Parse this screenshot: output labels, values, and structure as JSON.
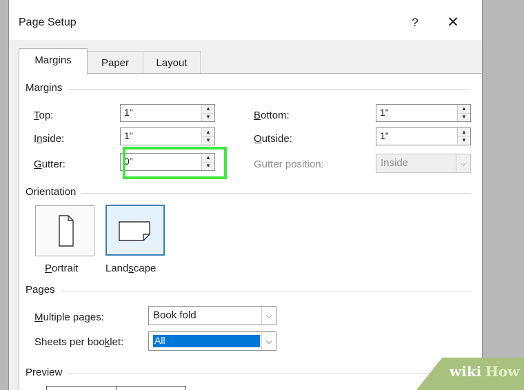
{
  "window": {
    "title": "Page Setup",
    "help": "?",
    "close": "✕"
  },
  "tabs": [
    {
      "label": "Margins",
      "active": true
    },
    {
      "label": "Paper"
    },
    {
      "label": "Layout"
    }
  ],
  "margins_section": {
    "title": "Margins",
    "top": {
      "key": "T",
      "rest": "op:",
      "value": "1\""
    },
    "inside": {
      "pre": "I",
      "key": "n",
      "rest": "side:",
      "value": "1\""
    },
    "gutter": {
      "key": "G",
      "rest": "utter:",
      "value": "0\""
    },
    "bottom": {
      "key": "B",
      "rest": "ottom:",
      "value": "1\""
    },
    "outside": {
      "key": "O",
      "rest": "utside:",
      "value": "1\""
    },
    "gutter_position": {
      "label": "Gutter position:",
      "value": "Inside"
    }
  },
  "orientation_section": {
    "title": "Orientation",
    "portrait": {
      "key": "P",
      "rest": "ortrait"
    },
    "landscape": {
      "pre": "Land",
      "key": "s",
      "rest": "cape"
    }
  },
  "pages_section": {
    "title": "Pages",
    "multiple_pages": {
      "key": "M",
      "rest": "ultiple pages:",
      "value": "Book fold"
    },
    "sheets_per_booklet": {
      "pre": "Sheets per boo",
      "key": "k",
      "rest": "let:",
      "value": "All"
    }
  },
  "preview_section": {
    "title": "Preview"
  },
  "watermark": {
    "wiki": "wiki",
    "how": "How"
  },
  "colors": {
    "highlight": "#3ee83e",
    "selection": "#0078d7"
  }
}
